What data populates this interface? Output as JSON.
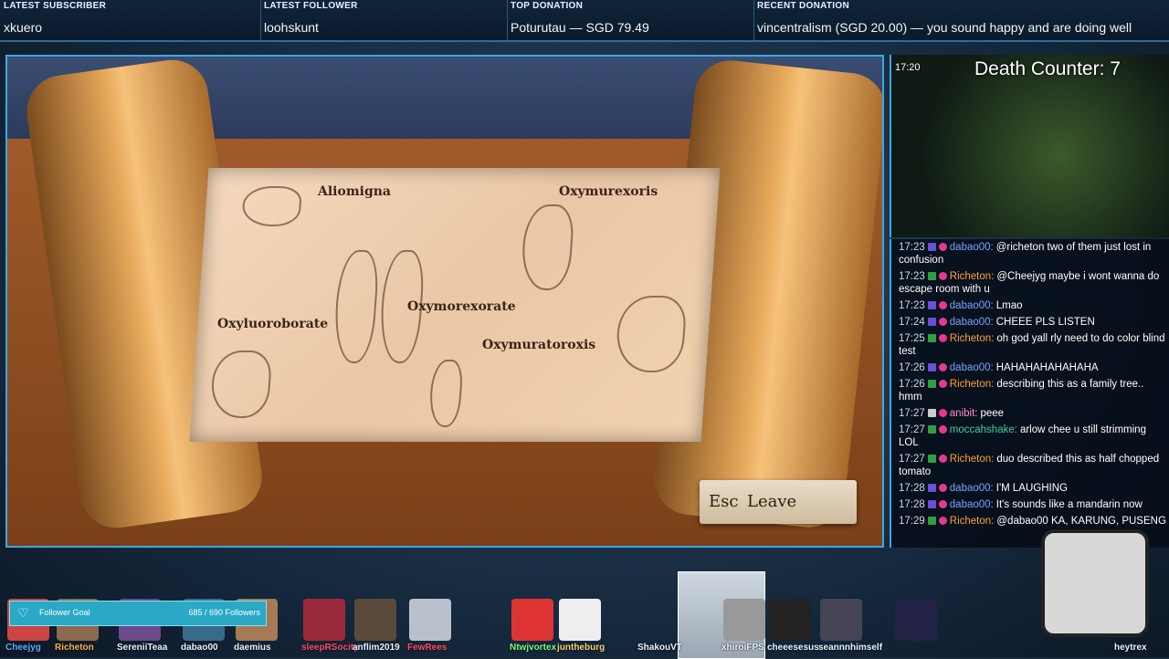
{
  "ticker": {
    "latest_subscriber": {
      "label": "LATEST SUBSCRIBER",
      "value": "xkuero"
    },
    "latest_follower": {
      "label": "LATEST FOLLOWER",
      "value": "loohskunt"
    },
    "top_donation": {
      "label": "TOP DONATION",
      "value": "Poturutau — SGD 79.49"
    },
    "recent_donation": {
      "label": "RECENT DONATION",
      "value": "vincentralism (SGD 20.00) — you sound happy and are doing well"
    }
  },
  "game": {
    "labels": [
      "Aliomigna",
      "Oxymurexoris",
      "Oxymorexorate",
      "Oxyluoroborate",
      "Oxymuratoroxis"
    ],
    "leave_key": "Esc",
    "leave_label": "Leave"
  },
  "overlay": {
    "death_counter": "Death Counter: 7",
    "cam_top_time": "17:20"
  },
  "chat": [
    {
      "time": "17:23",
      "user": "dabao00:",
      "user_color": "#7aa3ff",
      "text": "@richeton two of them just lost in confusion",
      "badge": "#6b4fd8"
    },
    {
      "time": "17:23",
      "user": "Richeton:",
      "user_color": "#ff9f3a",
      "text": "@Cheejyg maybe i wont wanna do escape room with u",
      "badge": "#2ea043"
    },
    {
      "time": "17:23",
      "user": "dabao00:",
      "user_color": "#7aa3ff",
      "text": "Lmao",
      "badge": "#6b4fd8"
    },
    {
      "time": "17:24",
      "user": "dabao00:",
      "user_color": "#7aa3ff",
      "text": "CHEEE PLS LISTEN",
      "badge": "#6b4fd8"
    },
    {
      "time": "17:25",
      "user": "Richeton:",
      "user_color": "#ff9f3a",
      "text": "oh god yall rly need to do color blind test",
      "badge": "#2ea043"
    },
    {
      "time": "17:26",
      "user": "dabao00:",
      "user_color": "#7aa3ff",
      "text": "HAHAHAHAHAHAHA",
      "badge": "#6b4fd8"
    },
    {
      "time": "17:26",
      "user": "Richeton:",
      "user_color": "#ff9f3a",
      "text": "describing this as a family tree.. hmm",
      "badge": "#2ea043"
    },
    {
      "time": "17:27",
      "user": "anibit:",
      "user_color": "#ff8bd0",
      "text": "peee",
      "badge": "#cccccc"
    },
    {
      "time": "17:27",
      "user": "moccahshake:",
      "user_color": "#3fd0a0",
      "text": "arlow chee u still strimming LOL",
      "badge": "#2ea043"
    },
    {
      "time": "17:27",
      "user": "Richeton:",
      "user_color": "#ff9f3a",
      "text": "duo described this as half chopped tomato",
      "badge": "#2ea043"
    },
    {
      "time": "17:28",
      "user": "dabao00:",
      "user_color": "#7aa3ff",
      "text": "I'M LAUGHING",
      "badge": "#6b4fd8"
    },
    {
      "time": "17:28",
      "user": "dabao00:",
      "user_color": "#7aa3ff",
      "text": "It's sounds like a mandarin now",
      "badge": "#6b4fd8"
    },
    {
      "time": "17:29",
      "user": "Richeton:",
      "user_color": "#ff9f3a",
      "text": "@dabao00 KA, KARUNG, PUSENG",
      "badge": "#2ea043"
    }
  ],
  "goal": {
    "label": "Follower Goal",
    "count": "685 / 690 Followers",
    "progress": 0.993
  },
  "supporters": [
    "Cheejyg",
    "Richeton",
    "SereniiTeaa",
    "dabao00",
    "daemius",
    "sleepRSocity",
    "anflim2019",
    "FewRees",
    "Ntwjvortex",
    "juntheburg",
    "ShakouVT",
    "xhiroiFPS",
    "cheeesesus",
    "seannnhimself",
    "heytrex"
  ],
  "icons": {
    "heart": "heart-icon",
    "goal": "follower-icon"
  }
}
